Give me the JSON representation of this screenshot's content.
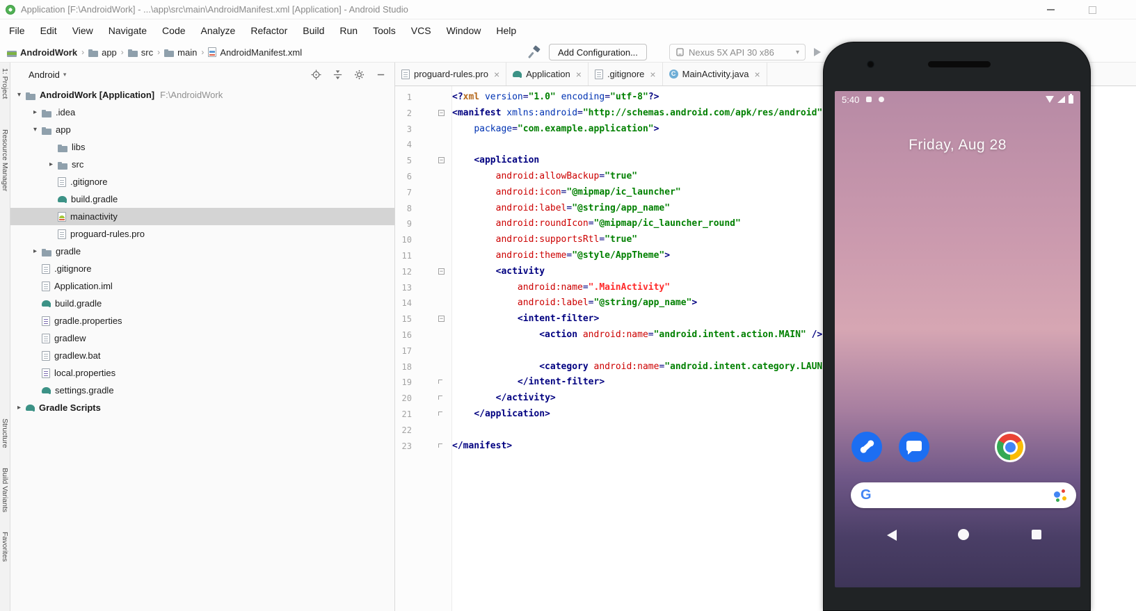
{
  "title_bar": {
    "title": "Application [F:\\AndroidWork] - ...\\app\\src\\main\\AndroidManifest.xml [Application] - Android Studio"
  },
  "menu": [
    "File",
    "Edit",
    "View",
    "Navigate",
    "Code",
    "Analyze",
    "Refactor",
    "Build",
    "Run",
    "Tools",
    "VCS",
    "Window",
    "Help"
  ],
  "toolbar": {
    "breadcrumbs": [
      {
        "label": "AndroidWork",
        "icon": "android-module",
        "bold": true
      },
      {
        "label": "app",
        "icon": "folder"
      },
      {
        "label": "src",
        "icon": "folder"
      },
      {
        "label": "main",
        "icon": "folder"
      },
      {
        "label": "AndroidManifest.xml",
        "icon": "manifest-file"
      }
    ],
    "add_configuration_label": "Add Configuration...",
    "device_selector_label": "Nexus 5X API 30 x86"
  },
  "tool_stripe": {
    "top": [
      "1: Project",
      "Resource Manager"
    ],
    "bottom": [
      "Structure",
      "Build Variants",
      "Favorites"
    ]
  },
  "project_panel": {
    "view_label": "Android",
    "tree": [
      {
        "label": "AndroidWork [Application]",
        "hint": "F:\\AndroidWork",
        "level": 0,
        "chevron": "down",
        "icon": "folder",
        "bold": true
      },
      {
        "label": ".idea",
        "level": 1,
        "chevron": "right",
        "icon": "folder"
      },
      {
        "label": "app",
        "level": 1,
        "chevron": "down",
        "icon": "folder"
      },
      {
        "label": "libs",
        "level": 2,
        "icon": "folder"
      },
      {
        "label": "src",
        "level": 2,
        "chevron": "right",
        "icon": "folder"
      },
      {
        "label": ".gitignore",
        "level": 2,
        "icon": "file"
      },
      {
        "label": "build.gradle",
        "level": 2,
        "icon": "gradle"
      },
      {
        "label": "mainactivity",
        "level": 2,
        "icon": "android-file",
        "selected": true
      },
      {
        "label": "proguard-rules.pro",
        "level": 2,
        "icon": "file"
      },
      {
        "label": "gradle",
        "level": 1,
        "chevron": "right",
        "icon": "folder"
      },
      {
        "label": ".gitignore",
        "level": 1,
        "icon": "file"
      },
      {
        "label": "Application.iml",
        "level": 1,
        "icon": "file"
      },
      {
        "label": "build.gradle",
        "level": 1,
        "icon": "gradle"
      },
      {
        "label": "gradle.properties",
        "level": 1,
        "icon": "properties"
      },
      {
        "label": "gradlew",
        "level": 1,
        "icon": "file"
      },
      {
        "label": "gradlew.bat",
        "level": 1,
        "icon": "file"
      },
      {
        "label": "local.properties",
        "level": 1,
        "icon": "properties"
      },
      {
        "label": "settings.gradle",
        "level": 1,
        "icon": "gradle"
      },
      {
        "label": "Gradle Scripts",
        "level": 0,
        "chevron": "right",
        "icon": "gradle",
        "bold": true
      }
    ]
  },
  "editor": {
    "tabs": [
      {
        "label": "proguard-rules.pro",
        "icon": "file"
      },
      {
        "label": "Application",
        "icon": "gradle"
      },
      {
        "label": ".gitignore",
        "icon": "file"
      },
      {
        "label": "MainActivity.java",
        "icon": "class"
      }
    ],
    "lines": [
      {
        "n": 1,
        "fold": "",
        "s": [
          [
            "<?",
            "tag"
          ],
          [
            "xml ",
            "pi"
          ],
          [
            "version",
            "attr"
          ],
          [
            "=",
            "eq"
          ],
          [
            "\"1.0\"",
            "val"
          ],
          [
            " ",
            "pl"
          ],
          [
            "encoding",
            "attr"
          ],
          [
            "=",
            "eq"
          ],
          [
            "\"utf-8\"",
            "val"
          ],
          [
            "?>",
            "tag"
          ]
        ]
      },
      {
        "n": 2,
        "fold": "minus",
        "s": [
          [
            "<manifest ",
            "tag"
          ],
          [
            "xmlns:android",
            "attr"
          ],
          [
            "=",
            "eq"
          ],
          [
            "\"http://schemas.android.com/apk/res/android\"",
            "val"
          ]
        ]
      },
      {
        "n": 3,
        "fold": "",
        "s": [
          [
            "    ",
            "pl"
          ],
          [
            "package",
            "attr"
          ],
          [
            "=",
            "eq"
          ],
          [
            "\"com.example.application\"",
            "val"
          ],
          [
            ">",
            "tag"
          ]
        ]
      },
      {
        "n": 4,
        "fold": "",
        "s": []
      },
      {
        "n": 5,
        "fold": "minus",
        "s": [
          [
            "    ",
            "pl"
          ],
          [
            "<application",
            "tag"
          ]
        ]
      },
      {
        "n": 6,
        "fold": "",
        "s": [
          [
            "        ",
            "pl"
          ],
          [
            "android:allowBackup",
            "ns"
          ],
          [
            "=",
            "eq"
          ],
          [
            "\"true\"",
            "val"
          ]
        ]
      },
      {
        "n": 7,
        "fold": "",
        "s": [
          [
            "        ",
            "pl"
          ],
          [
            "android:icon",
            "ns"
          ],
          [
            "=",
            "eq"
          ],
          [
            "\"@mipmap/ic_launcher\"",
            "val"
          ]
        ]
      },
      {
        "n": 8,
        "fold": "",
        "s": [
          [
            "        ",
            "pl"
          ],
          [
            "android:label",
            "ns"
          ],
          [
            "=",
            "eq"
          ],
          [
            "\"@string/app_name\"",
            "val"
          ]
        ]
      },
      {
        "n": 9,
        "fold": "",
        "s": [
          [
            "        ",
            "pl"
          ],
          [
            "android:roundIcon",
            "ns"
          ],
          [
            "=",
            "eq"
          ],
          [
            "\"@mipmap/ic_launcher_round\"",
            "val"
          ]
        ]
      },
      {
        "n": 10,
        "fold": "",
        "s": [
          [
            "        ",
            "pl"
          ],
          [
            "android:supportsRtl",
            "ns"
          ],
          [
            "=",
            "eq"
          ],
          [
            "\"true\"",
            "val"
          ]
        ]
      },
      {
        "n": 11,
        "fold": "",
        "s": [
          [
            "        ",
            "pl"
          ],
          [
            "android:theme",
            "ns"
          ],
          [
            "=",
            "eq"
          ],
          [
            "\"@style/AppTheme\"",
            "val"
          ],
          [
            ">",
            "tag"
          ]
        ]
      },
      {
        "n": 12,
        "fold": "minus",
        "s": [
          [
            "        ",
            "pl"
          ],
          [
            "<activity",
            "tag"
          ]
        ]
      },
      {
        "n": 13,
        "fold": "",
        "s": [
          [
            "            ",
            "pl"
          ],
          [
            "android:name",
            "ns"
          ],
          [
            "=",
            "eq"
          ],
          [
            "\".MainActivity\"",
            "err"
          ]
        ]
      },
      {
        "n": 14,
        "fold": "",
        "s": [
          [
            "            ",
            "pl"
          ],
          [
            "android:label",
            "ns"
          ],
          [
            "=",
            "eq"
          ],
          [
            "\"@string/app_name\"",
            "val"
          ],
          [
            ">",
            "tag"
          ]
        ]
      },
      {
        "n": 15,
        "fold": "minus",
        "s": [
          [
            "            ",
            "pl"
          ],
          [
            "<intent-filter>",
            "tag"
          ]
        ]
      },
      {
        "n": 16,
        "fold": "",
        "s": [
          [
            "                ",
            "pl"
          ],
          [
            "<action ",
            "tag"
          ],
          [
            "android:name",
            "ns"
          ],
          [
            "=",
            "eq"
          ],
          [
            "\"android.intent.action.MAIN\"",
            "val"
          ],
          [
            " />",
            "tag"
          ]
        ]
      },
      {
        "n": 17,
        "fold": "",
        "s": []
      },
      {
        "n": 18,
        "fold": "",
        "s": [
          [
            "                ",
            "pl"
          ],
          [
            "<category ",
            "tag"
          ],
          [
            "android:name",
            "ns"
          ],
          [
            "=",
            "eq"
          ],
          [
            "\"android.intent.category.LAUNCHER\"",
            "val"
          ],
          [
            " />",
            "tag"
          ]
        ]
      },
      {
        "n": 19,
        "fold": "end",
        "s": [
          [
            "            ",
            "pl"
          ],
          [
            "</intent-filter>",
            "tag"
          ]
        ]
      },
      {
        "n": 20,
        "fold": "end",
        "s": [
          [
            "        ",
            "pl"
          ],
          [
            "</activity>",
            "tag"
          ]
        ]
      },
      {
        "n": 21,
        "fold": "end",
        "s": [
          [
            "    ",
            "pl"
          ],
          [
            "</application>",
            "tag"
          ]
        ]
      },
      {
        "n": 22,
        "fold": "",
        "s": []
      },
      {
        "n": 23,
        "fold": "end",
        "s": [
          [
            "</manifest>",
            "tag"
          ]
        ]
      }
    ]
  },
  "emulator": {
    "time": "5:40",
    "date": "Friday, Aug 28",
    "dock": [
      "phone",
      "messages",
      "chrome"
    ],
    "nav": [
      "back",
      "home",
      "recents"
    ]
  },
  "glyphs": {
    "close": "×",
    "chevron_down": "▾",
    "chevron_right": "▸",
    "breadcrumb_sep": "›",
    "fold_minus": "−",
    "panel_caret": "▾"
  },
  "colors": {
    "selection": "#d4d4d4",
    "gradle_teal": "#3c9286",
    "xml_tag": "#000080",
    "xml_attribute": "#0033b3",
    "xml_ns_attribute": "#cc0000",
    "xml_value": "#008000",
    "dock_icon_blue": "#1c6ef2"
  }
}
